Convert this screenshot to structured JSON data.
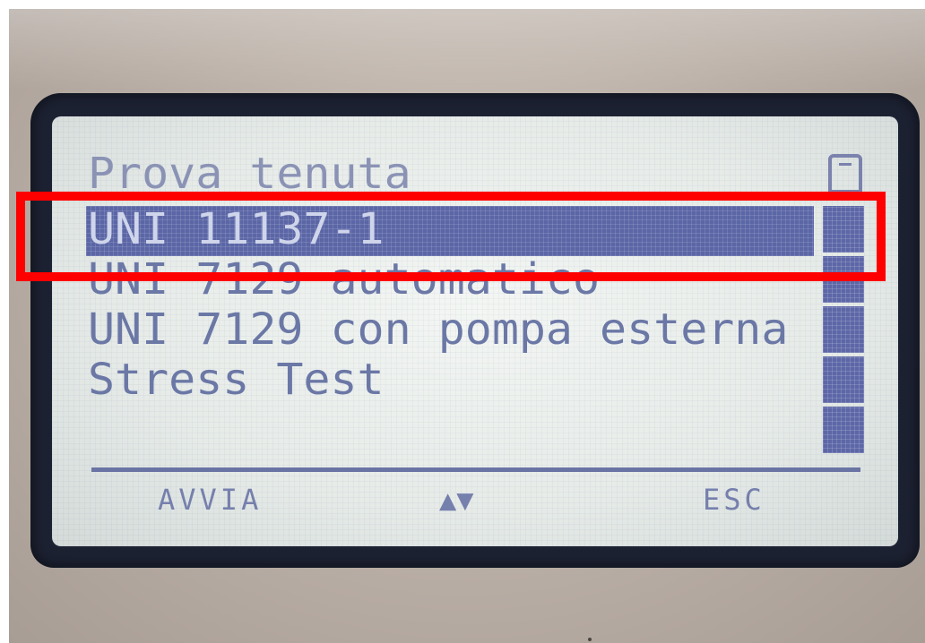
{
  "screen": {
    "title": "Prova tenuta",
    "menu_items": [
      {
        "label": "UNI 11137-1",
        "selected": true
      },
      {
        "label": "UNI 7129 automatico",
        "selected": false
      },
      {
        "label": "UNI 7129 con pompa esterna",
        "selected": false
      },
      {
        "label": "Stress Test",
        "selected": false
      }
    ]
  },
  "softkeys": {
    "left": "AVVIA",
    "middle": "▲▼",
    "right": "ESC"
  },
  "icons": {
    "scroll_top": "scroll-up-cap-icon",
    "nav": "up-down-arrows-icon"
  },
  "colors": {
    "lcd_text": "#6b78a6",
    "selection": "#5b66a6",
    "lcd_background": "#e6ebe8",
    "bezel": "#1d2233",
    "annotation": "#ff0000"
  }
}
